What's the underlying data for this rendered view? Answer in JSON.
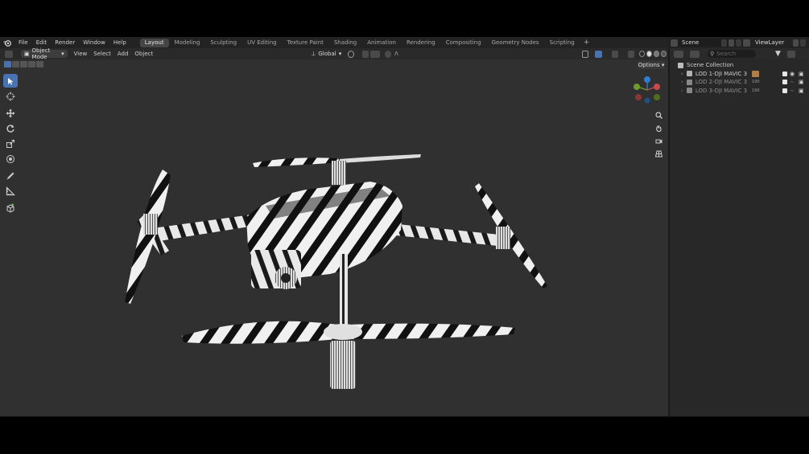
{
  "menu": [
    "File",
    "Edit",
    "Render",
    "Window",
    "Help"
  ],
  "workspaces": [
    {
      "label": "Layout",
      "active": true
    },
    {
      "label": "Modeling",
      "active": false
    },
    {
      "label": "Sculpting",
      "active": false
    },
    {
      "label": "UV Editing",
      "active": false
    },
    {
      "label": "Texture Paint",
      "active": false
    },
    {
      "label": "Shading",
      "active": false
    },
    {
      "label": "Animation",
      "active": false
    },
    {
      "label": "Rendering",
      "active": false
    },
    {
      "label": "Compositing",
      "active": false
    },
    {
      "label": "Geometry Nodes",
      "active": false
    },
    {
      "label": "Scripting",
      "active": false
    }
  ],
  "add_workspace": "+",
  "scene": {
    "name": "Scene"
  },
  "view_layer": {
    "name": "ViewLayer"
  },
  "header": {
    "mode": "Object Mode",
    "menus": [
      "View",
      "Select",
      "Add",
      "Object"
    ],
    "orientation": "Global",
    "options_label": "Options"
  },
  "outliner": {
    "search_placeholder": "Search",
    "collection": "Scene Collection",
    "items": [
      {
        "label": "LOD 1-DJI MAVIC 3",
        "dim": false,
        "badge_color": "#b07e4a"
      },
      {
        "label": "LOD 2-DJI MAVIC 3",
        "dim": true,
        "badge_text": "190"
      },
      {
        "label": "LOD 3-DJI MAVIC 3",
        "dim": true,
        "badge_text": "190"
      }
    ]
  },
  "gizmo": {
    "z_label": "Z",
    "x_label": "X",
    "y_label": "Y"
  },
  "colors": {
    "accent": "#4772b3",
    "x_axis": "#c8494d",
    "y_axis": "#6d9a2c",
    "z_axis": "#2e7fd1"
  }
}
